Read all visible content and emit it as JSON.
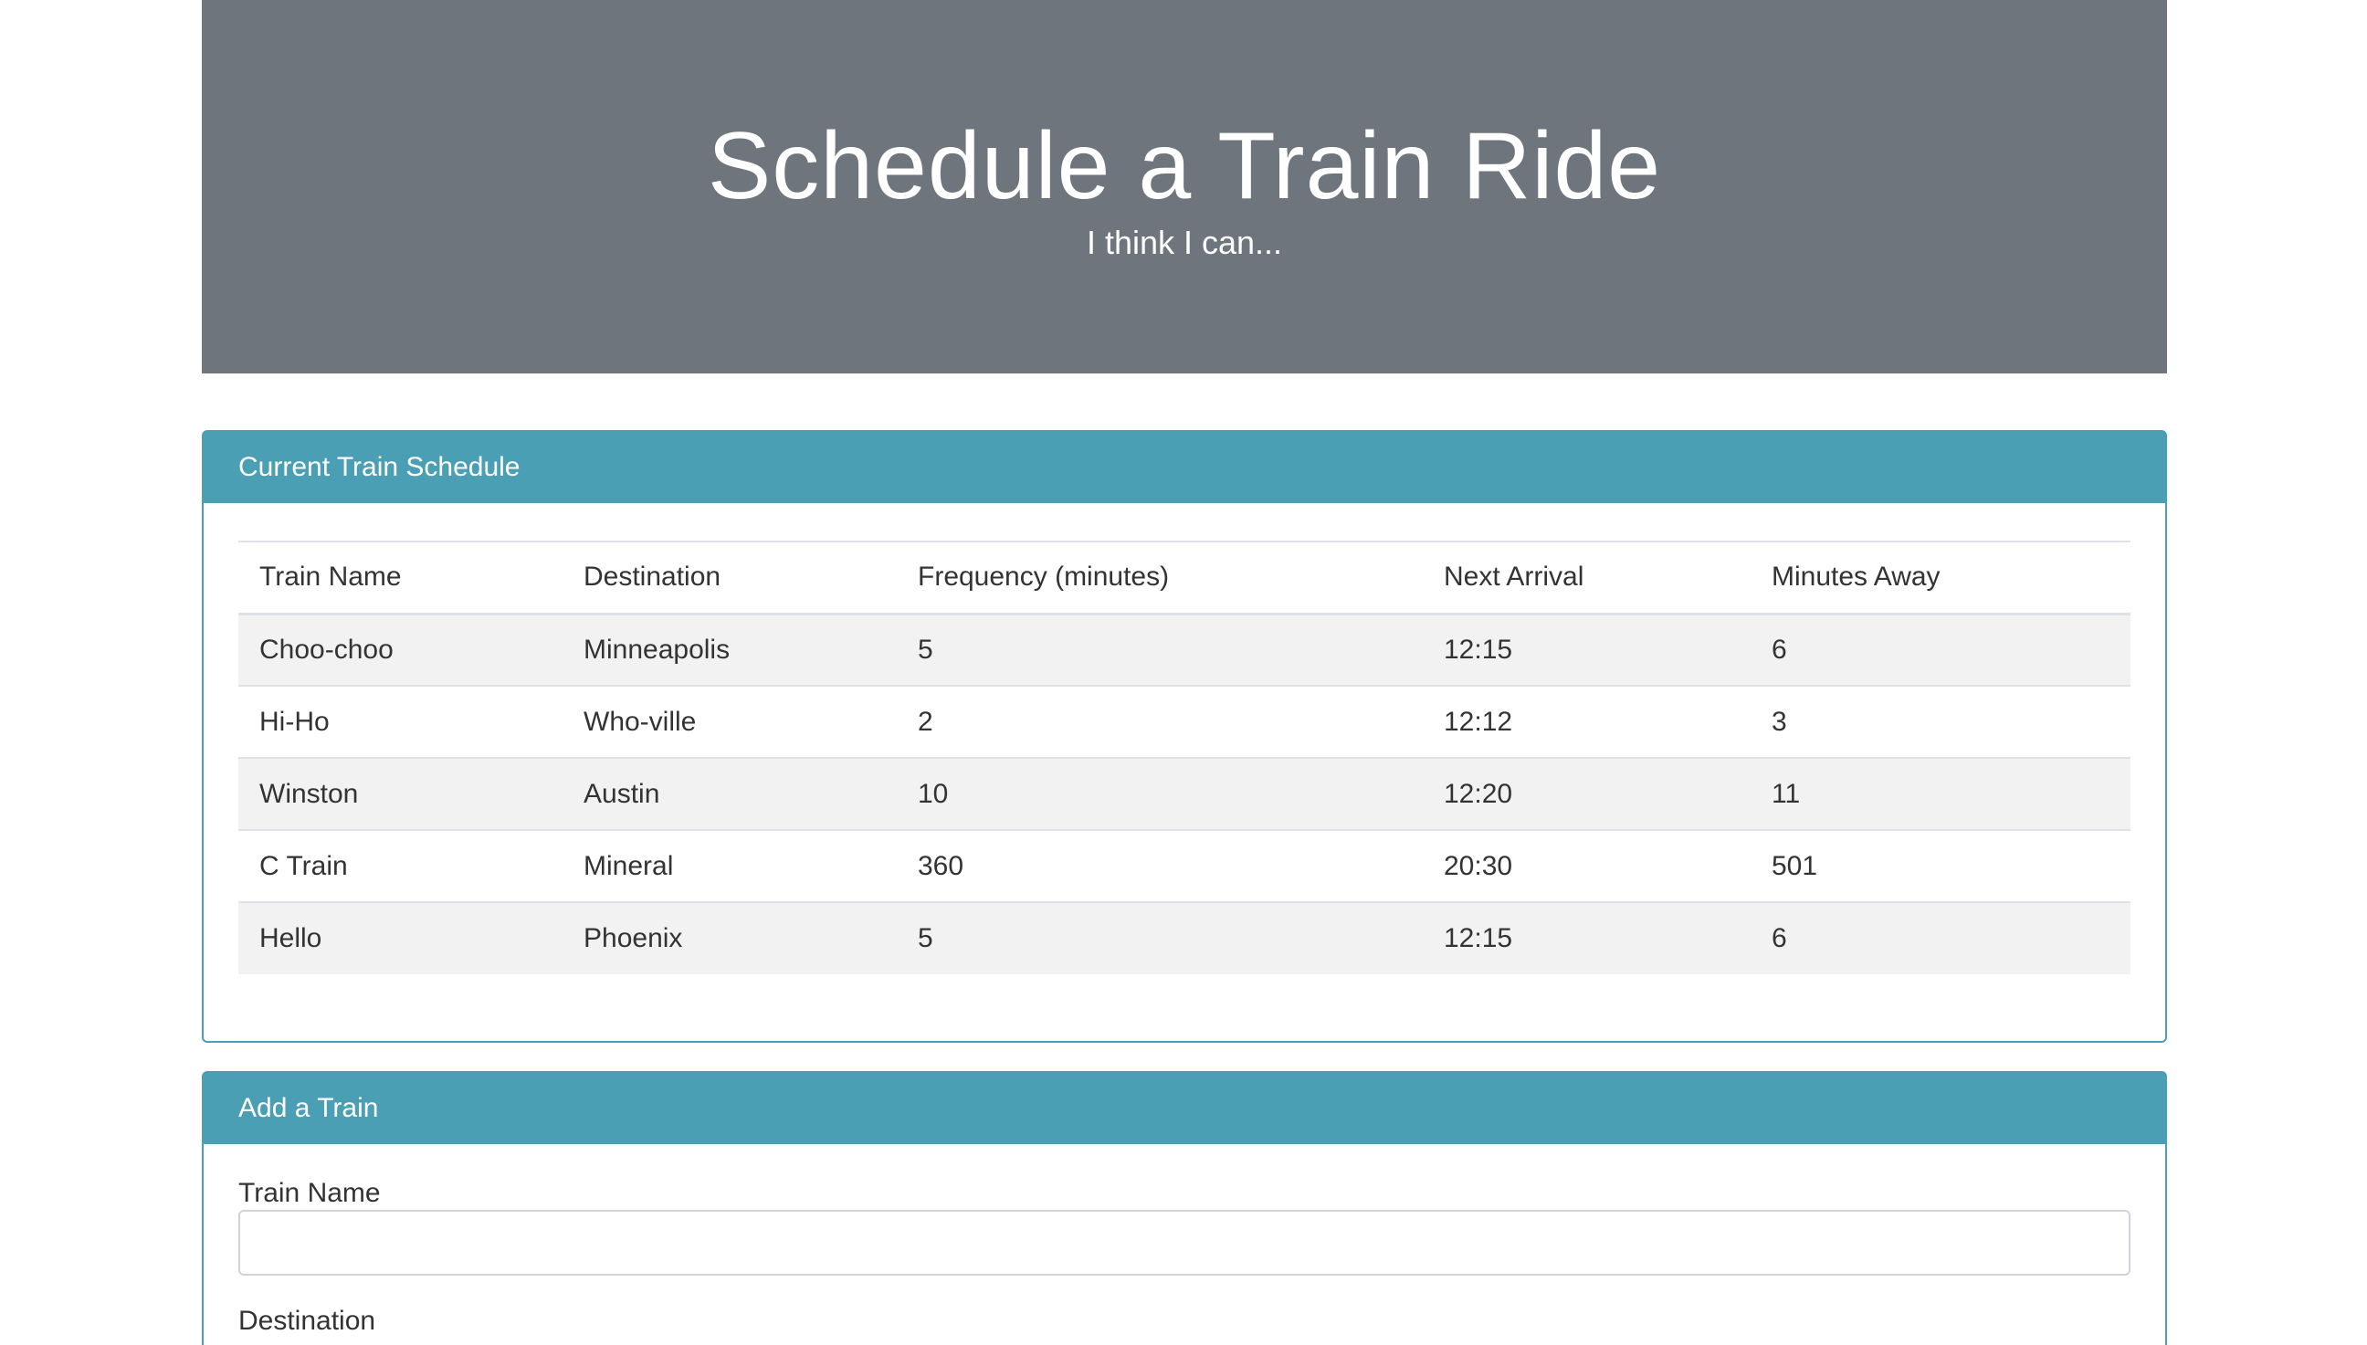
{
  "header": {
    "title": "Schedule a Train Ride",
    "subtitle": "I think I can..."
  },
  "schedule": {
    "panel_title": "Current Train Schedule",
    "columns": [
      "Train Name",
      "Destination",
      "Frequency (minutes)",
      "Next Arrival",
      "Minutes Away"
    ],
    "rows": [
      [
        "Choo-choo",
        "Minneapolis",
        "5",
        "12:15",
        "6"
      ],
      [
        "Hi-Ho",
        "Who-ville",
        "2",
        "12:12",
        "3"
      ],
      [
        "Winston",
        "Austin",
        "10",
        "12:20",
        "11"
      ],
      [
        "C Train",
        "Mineral",
        "360",
        "20:30",
        "501"
      ],
      [
        "Hello",
        "Phoenix",
        "5",
        "12:15",
        "6"
      ]
    ]
  },
  "add_train": {
    "panel_title": "Add a Train",
    "train_name_label": "Train Name",
    "train_name_value": "",
    "destination_label": "Destination"
  },
  "colors": {
    "jumbotron_bg": "#6e757d",
    "panel_accent": "#4a9fb5"
  }
}
